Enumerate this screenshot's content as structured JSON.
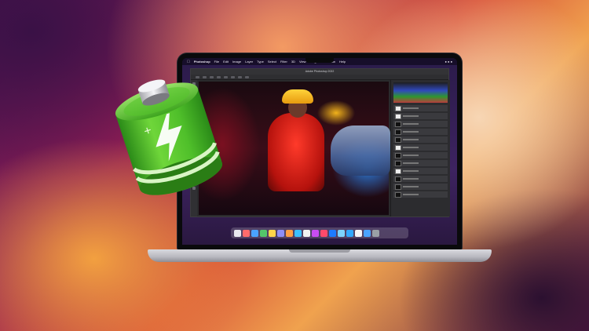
{
  "menubar": {
    "app_name": "Photoshop",
    "items": [
      "File",
      "Edit",
      "Image",
      "Layer",
      "Type",
      "Select",
      "Filter",
      "3D",
      "View",
      "Plugins",
      "Window",
      "Help"
    ]
  },
  "ps": {
    "window_title": "Adobe Photoshop 2022"
  },
  "icons": {
    "battery": "battery-charging-icon",
    "apple": "apple-icon"
  },
  "colors": {
    "battery_green": "#4fbf2a",
    "battery_dark": "#2a8a18",
    "bolt": "#ffffff"
  },
  "dock": {
    "app_colors": [
      "#e8e8ee",
      "#ff6b6b",
      "#4aa3ff",
      "#54c76a",
      "#ffd54a",
      "#8e8ef7",
      "#ff9f43",
      "#3ac0ff",
      "#f2f2f2",
      "#c94cf2",
      "#ff4a6b",
      "#1d7bff",
      "#7dd3fc",
      "#31a8ff",
      "#f5f5f7",
      "#4aa3ff",
      "#9aa0a6"
    ]
  }
}
